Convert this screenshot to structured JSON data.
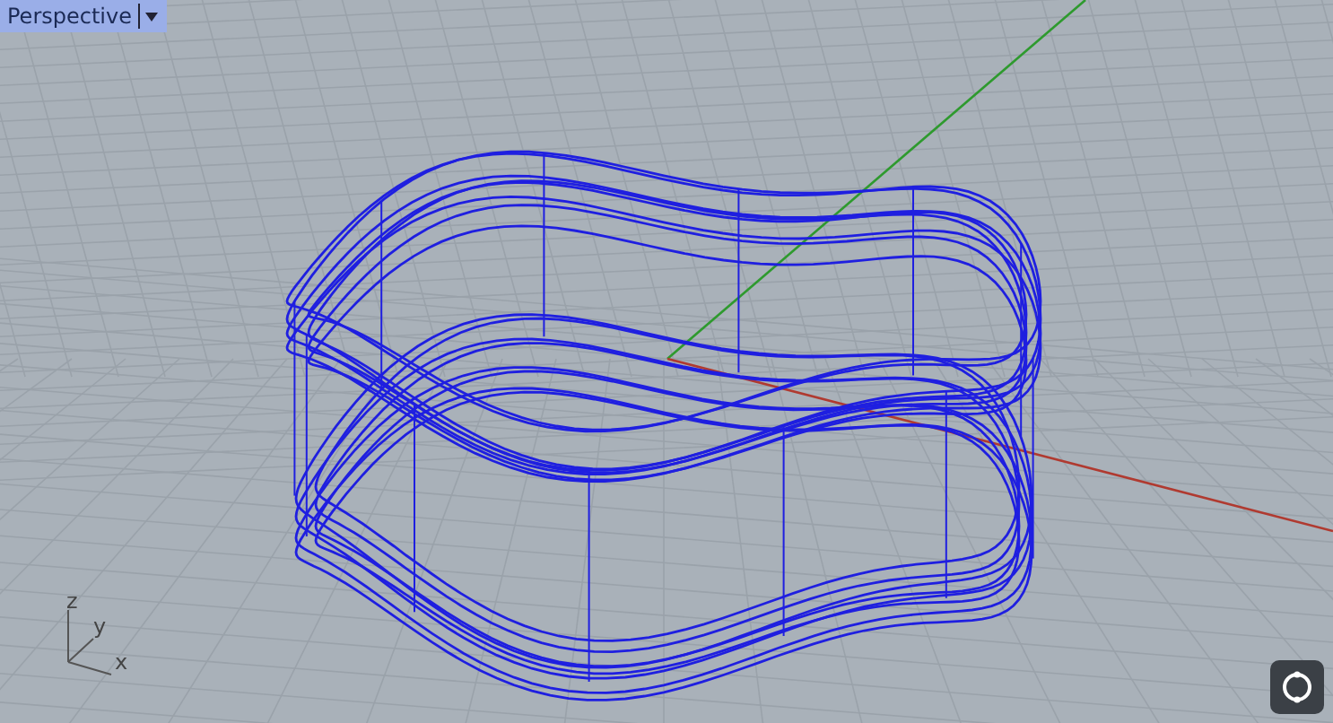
{
  "viewport": {
    "title": "Perspective"
  },
  "axis_labels": [
    {
      "axis": "z"
    },
    {
      "axis": "y"
    },
    {
      "axis": "x"
    }
  ]
}
